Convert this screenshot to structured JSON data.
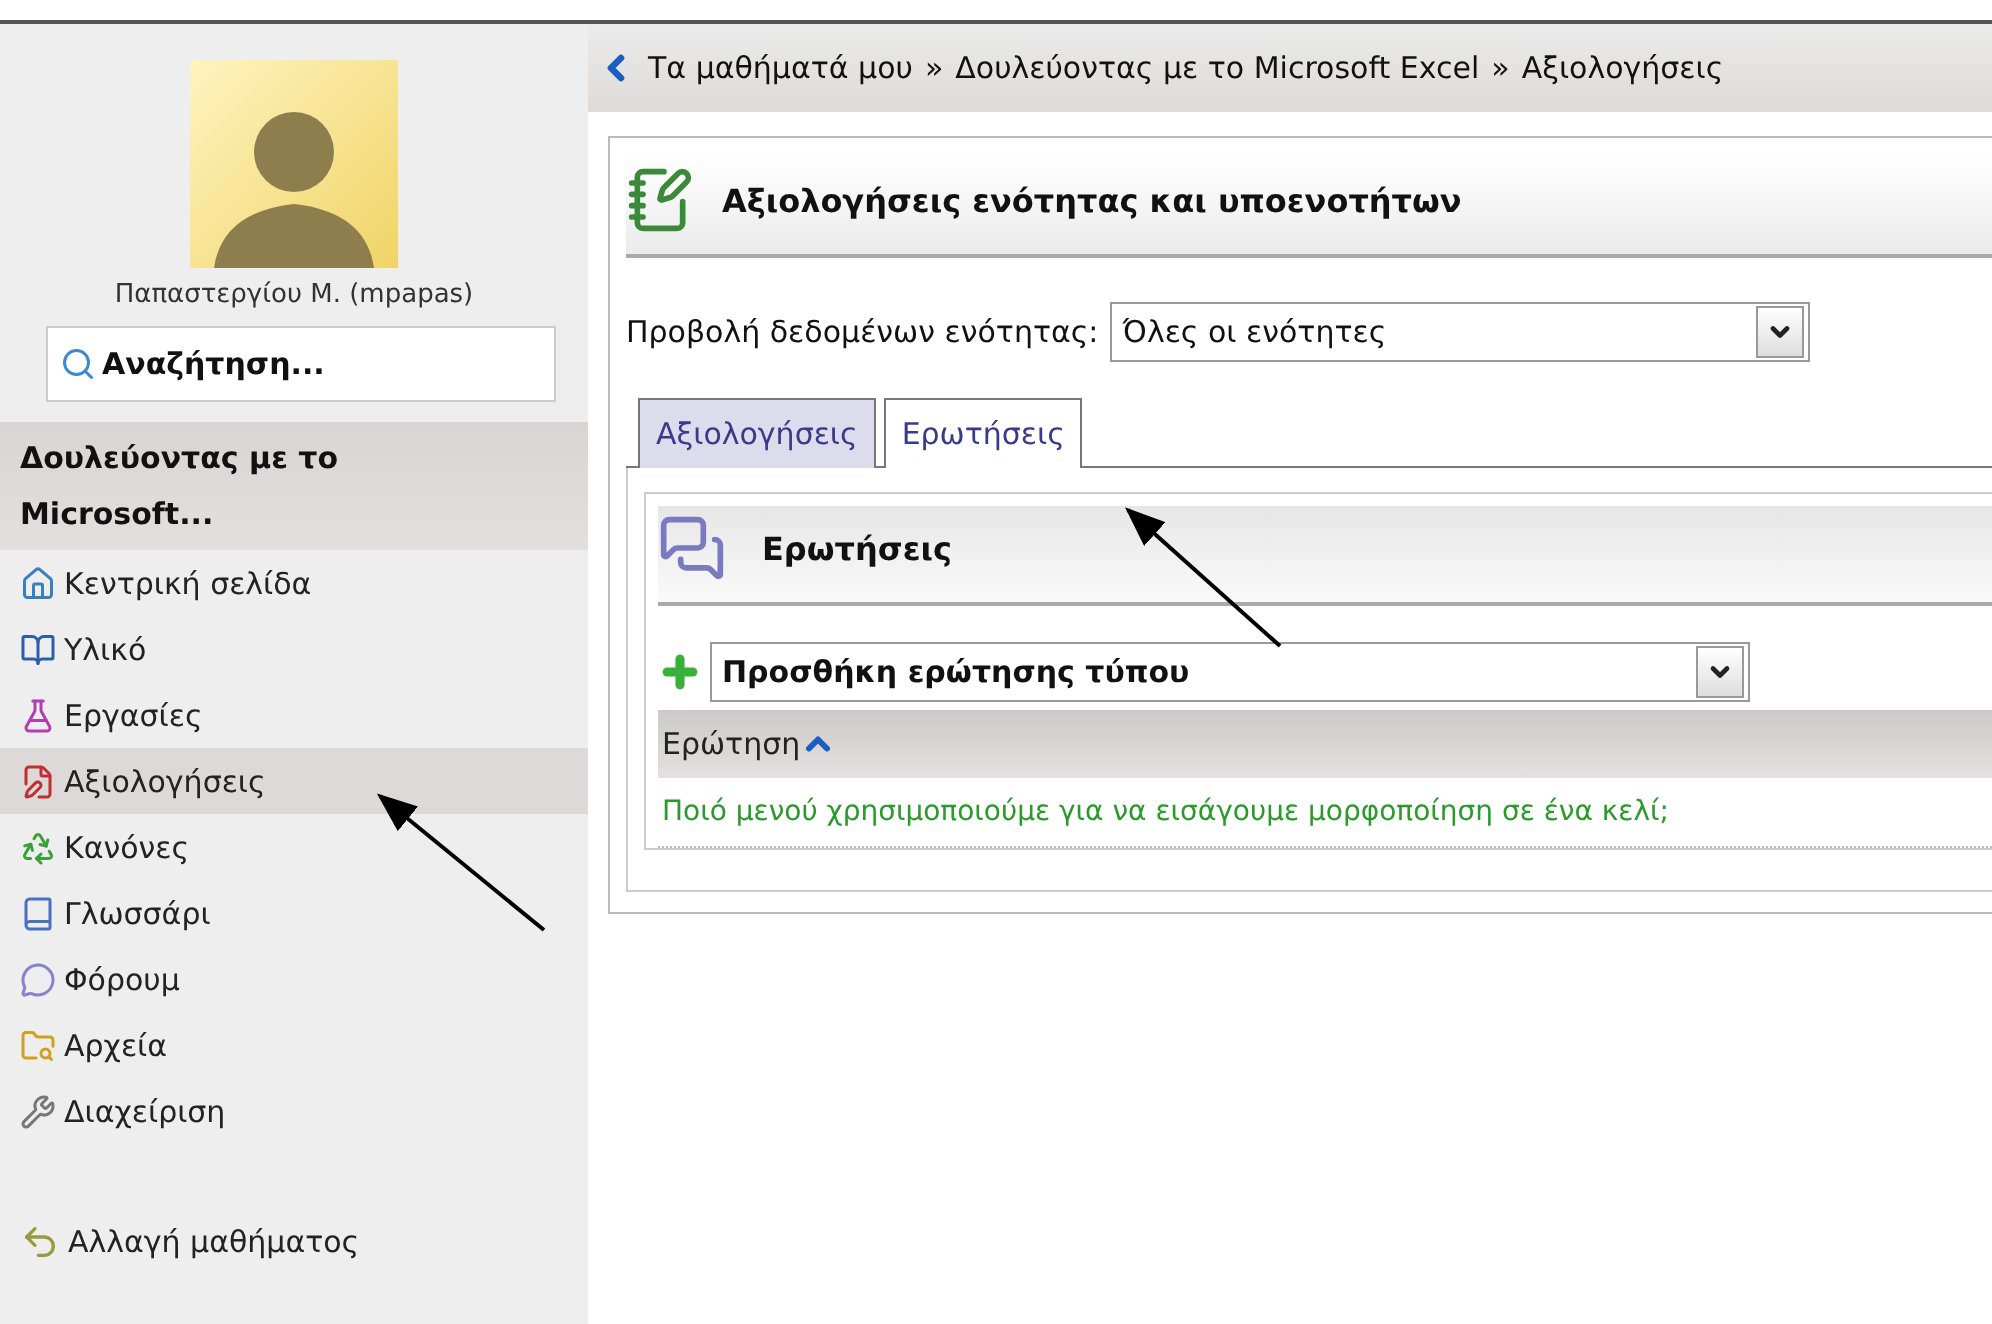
{
  "user": {
    "name": "Παπαστεργίου Μ. (mpapas)"
  },
  "search": {
    "value": "Αναζήτηση..."
  },
  "course": {
    "title": "Δουλεύοντας με το Microsoft..."
  },
  "sidebar": {
    "items": [
      {
        "kind": "home",
        "label": "Κεντρική σελίδα",
        "selected": false
      },
      {
        "kind": "material",
        "label": "Υλικό",
        "selected": false
      },
      {
        "kind": "tasks",
        "label": "Εργασίες",
        "selected": false
      },
      {
        "kind": "grades",
        "label": "Αξιολογήσεις",
        "selected": true
      },
      {
        "kind": "rules",
        "label": "Κανόνες",
        "selected": false
      },
      {
        "kind": "glossary",
        "label": "Γλωσσάρι",
        "selected": false
      },
      {
        "kind": "forum",
        "label": "Φόρουμ",
        "selected": false
      },
      {
        "kind": "files",
        "label": "Αρχεία",
        "selected": false
      },
      {
        "kind": "admin",
        "label": "Διαχείριση",
        "selected": false
      }
    ],
    "change_course": "Αλλαγή μαθήματος"
  },
  "breadcrumb": [
    "Τα μαθήματά μου",
    "»",
    "Δουλεύοντας με το Microsoft Excel",
    "»",
    "Αξιολογήσεις"
  ],
  "panel": {
    "title": "Αξιολογήσεις ενότητας και υποενοτήτων",
    "filter": {
      "label": "Προβολή δεδομένων ενότητας:",
      "value": "Όλες οι ενότητες"
    },
    "tabs": [
      {
        "label": "Αξιολογήσεις",
        "selected": false
      },
      {
        "label": "Ερωτήσεις",
        "selected": true
      }
    ],
    "section": {
      "title": "Ερωτήσεις",
      "add_select": "Προσθήκη ερώτησης τύπου",
      "table": {
        "column": "Ερώτηση",
        "rows": [
          "Ποιό μενού χρησιμοποιούμε για να εισάγουμε μορφοποίηση σε ένα κελί;"
        ]
      }
    }
  }
}
